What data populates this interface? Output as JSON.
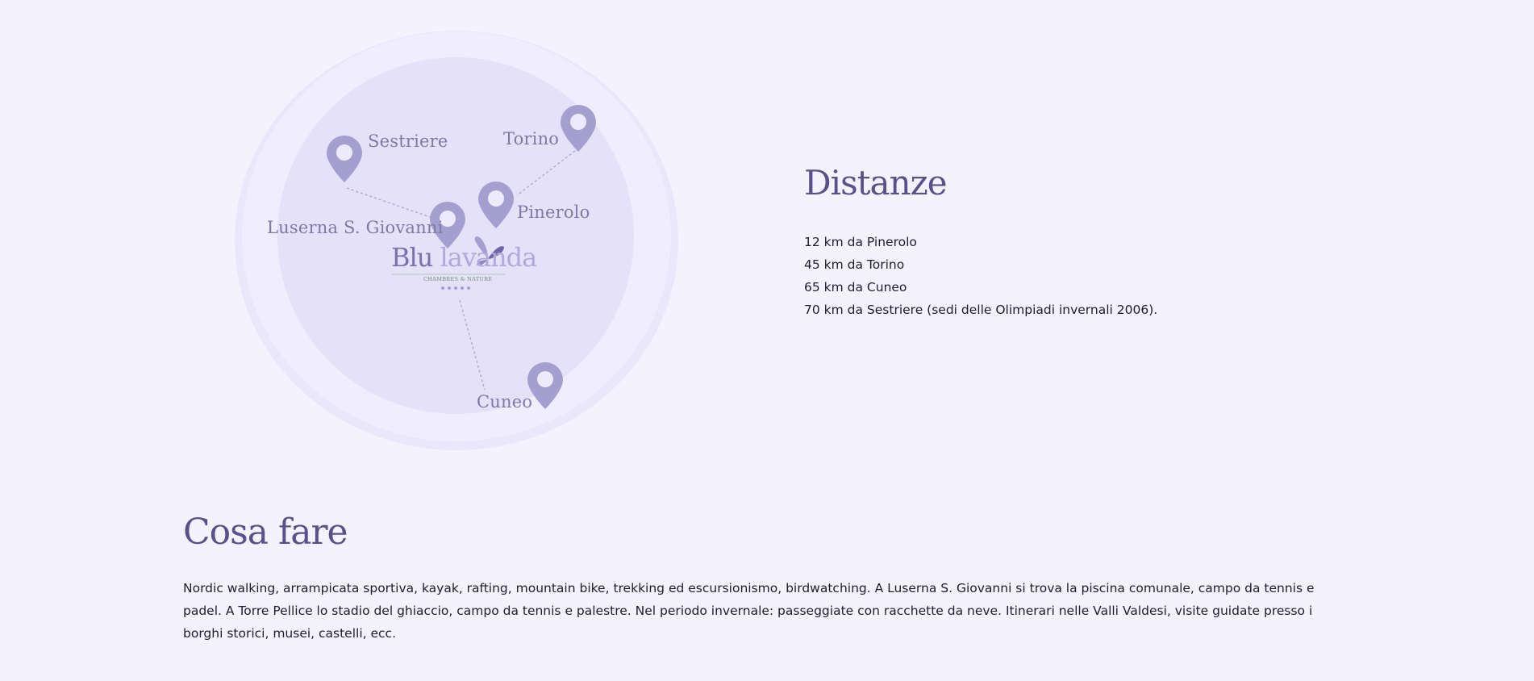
{
  "map": {
    "labels": {
      "sestriere": "Sestriere",
      "torino": "Torino",
      "pinerolo": "Pinerolo",
      "luserna": "Luserna S. Giovanni",
      "cuneo": "Cuneo"
    },
    "logo": {
      "blu": "Blu",
      "lavanda": "lavanda",
      "tagline": "CHAMBRES & NATURE"
    },
    "colors": {
      "pin": "#a49fcf",
      "outer_circle": "#ece9fd",
      "inner_circle": "#e4e1f8"
    }
  },
  "distanze": {
    "title": "Distanze",
    "items": [
      "12 km da Pinerolo",
      "45 km da Torino",
      "65 km da Cuneo",
      "70 km da Sestriere (sedi delle Olimpiadi invernali 2006)."
    ]
  },
  "cosa_fare": {
    "title": "Cosa fare",
    "text": "Nordic walking, arrampicata sportiva, kayak, rafting, mountain bike, trekking ed escursionismo, birdwatching. A Luserna S. Giovanni si trova la piscina comunale, campo da tennis e padel. A Torre Pellice lo stadio del ghiaccio, campo da tennis e palestre. Nel periodo invernale: passeggiate con racchette da neve. Itinerari nelle Valli Valdesi, visite guidate presso i borghi storici, musei, castelli, ecc."
  }
}
